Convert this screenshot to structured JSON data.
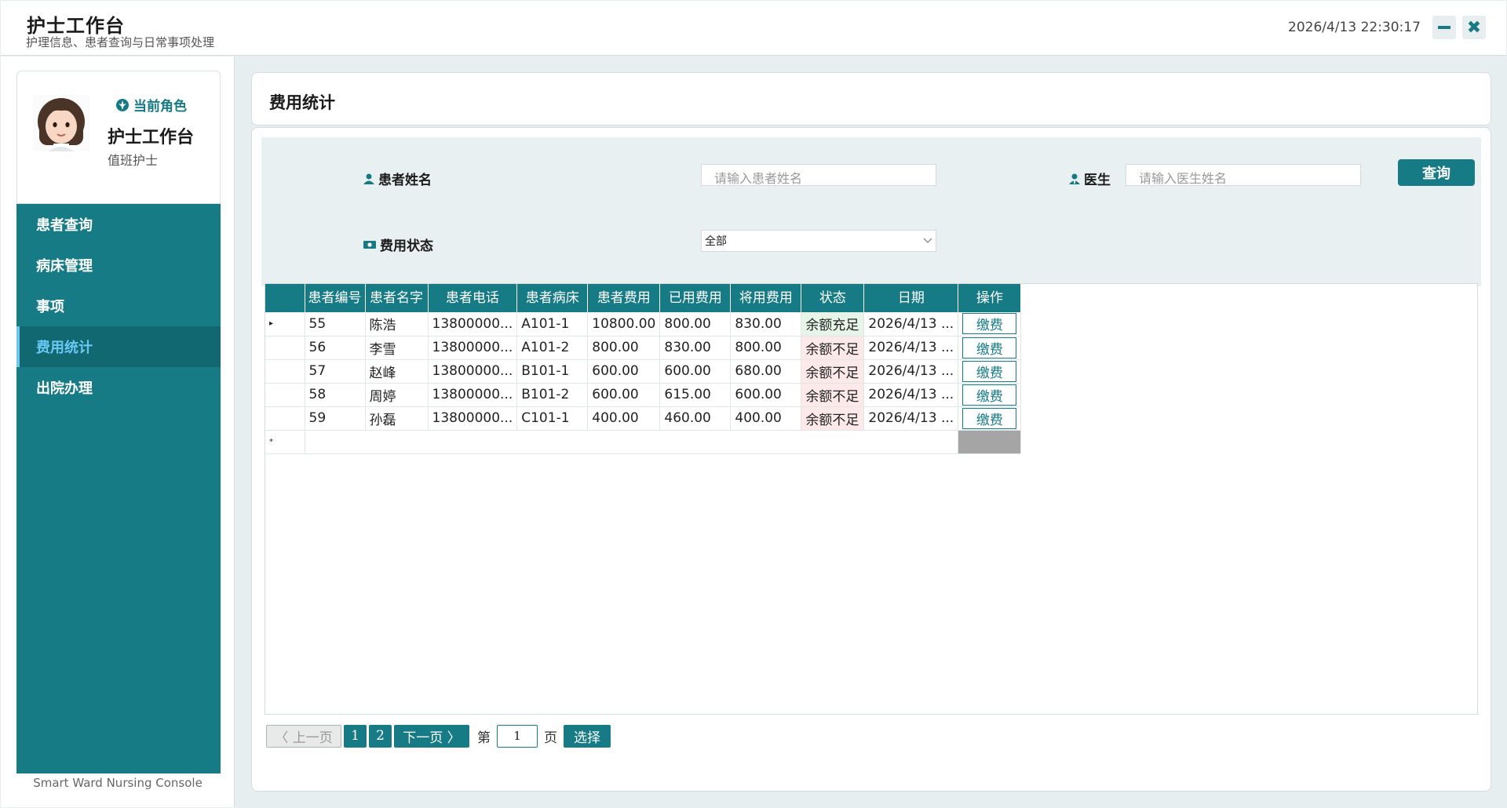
{
  "app": {
    "title": "护士工作台",
    "subtitle": "护理信息、患者查询与日常事项处理",
    "datetime": "2026/4/13 22:30:17",
    "minimize_icon": "minimize-icon",
    "close_icon": "close-icon",
    "close_glyph": "✖"
  },
  "profile": {
    "role_caption": "当前角色",
    "role_name": "护士工作台",
    "role_sub": "值班护士"
  },
  "sidebar": {
    "items": [
      {
        "label": "患者查询"
      },
      {
        "label": "病床管理"
      },
      {
        "label": "事项"
      },
      {
        "label": "费用统计",
        "active": true
      },
      {
        "label": "出院办理"
      }
    ],
    "footer": "Smart Ward Nursing Console"
  },
  "page": {
    "title": "费用统计"
  },
  "filters": {
    "patient_label": "患者姓名",
    "patient_placeholder": "请输入患者姓名",
    "doctor_label": "医生",
    "doctor_placeholder": "请输入医生姓名",
    "status_label": "费用状态",
    "status_value": "全部",
    "query_label": "查询"
  },
  "grid": {
    "columns": [
      "患者编号",
      "患者名字",
      "患者电话",
      "患者病床",
      "患者费用",
      "已用费用",
      "将用费用",
      "状态",
      "日期",
      "操作"
    ],
    "rows": [
      {
        "id": "55",
        "name": "陈浩",
        "phone": "13800000...",
        "bed": "A101-1",
        "fee": "10800.00",
        "used": "800.00",
        "pending": "830.00",
        "status": "余额充足",
        "status_ok": true,
        "date": "2026/4/13 ...",
        "action": "缴费"
      },
      {
        "id": "56",
        "name": "李雪",
        "phone": "13800000...",
        "bed": "A101-2",
        "fee": "800.00",
        "used": "830.00",
        "pending": "800.00",
        "status": "余额不足",
        "status_ok": false,
        "date": "2026/4/13 ...",
        "action": "缴费"
      },
      {
        "id": "57",
        "name": "赵峰",
        "phone": "13800000...",
        "bed": "B101-1",
        "fee": "600.00",
        "used": "600.00",
        "pending": "680.00",
        "status": "余额不足",
        "status_ok": false,
        "date": "2026/4/13 ...",
        "action": "缴费"
      },
      {
        "id": "58",
        "name": "周婷",
        "phone": "13800000...",
        "bed": "B101-2",
        "fee": "600.00",
        "used": "615.00",
        "pending": "600.00",
        "status": "余额不足",
        "status_ok": false,
        "date": "2026/4/13 ...",
        "action": "缴费"
      },
      {
        "id": "59",
        "name": "孙磊",
        "phone": "13800000...",
        "bed": "C101-1",
        "fee": "400.00",
        "used": "460.00",
        "pending": "400.00",
        "status": "余额不足",
        "status_ok": false,
        "date": "2026/4/13 ...",
        "action": "缴费"
      }
    ],
    "current_row_marker": "▸",
    "new_row_marker": "*"
  },
  "pager": {
    "prev": "〈 上一页",
    "pages": [
      "1",
      "2"
    ],
    "next": "下一页 〉",
    "page_prefix": "第",
    "page_value": "1",
    "page_suffix": "页",
    "select_label": "选择"
  },
  "colors": {
    "primary": "#177b86",
    "active_nav_text": "#69c8f2",
    "ok_bg": "#e7f5e9",
    "bad_bg": "#fde9ea",
    "bad_text": "#d43a3a"
  }
}
